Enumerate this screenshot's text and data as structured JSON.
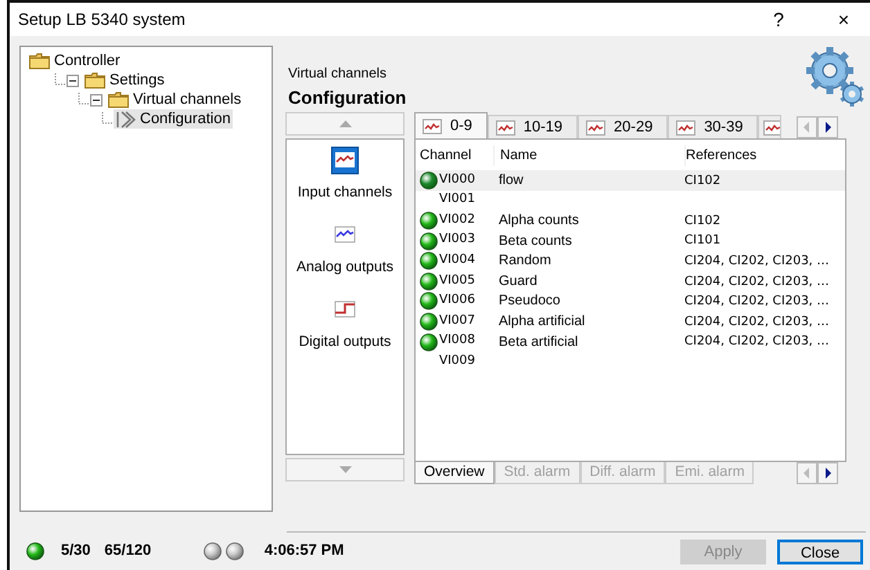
{
  "window": {
    "title": "Setup LB 5340 system",
    "help": "?",
    "close": "×"
  },
  "tree": [
    {
      "label": "Controller",
      "kind": "folder",
      "selected": false,
      "children": [
        {
          "label": "Settings",
          "kind": "folder",
          "expanded": true,
          "selected": false,
          "children": [
            {
              "label": "Virtual channels",
              "kind": "folder",
              "expanded": true,
              "selected": false,
              "children": [
                {
                  "label": "Configuration",
                  "kind": "page",
                  "selected": true
                }
              ]
            }
          ]
        }
      ]
    }
  ],
  "header": {
    "subtitle": "Virtual channels",
    "title": "Configuration"
  },
  "nav": {
    "items": [
      {
        "label": "Input channels",
        "kind": "input",
        "selected": true
      },
      {
        "label": "Analog outputs",
        "kind": "analog",
        "selected": false
      },
      {
        "label": "Digital outputs",
        "kind": "digital",
        "selected": false
      }
    ]
  },
  "tabs": [
    {
      "label": "0-9",
      "selected": true
    },
    {
      "label": "10-19",
      "selected": false
    },
    {
      "label": "20-29",
      "selected": false
    },
    {
      "label": "30-39",
      "selected": false
    },
    {
      "selected": false
    }
  ],
  "table": {
    "columns": [
      "Channel",
      "Name",
      "References"
    ],
    "rows": [
      {
        "channel": "VI000",
        "name": "flow",
        "references": "CI102",
        "led": true,
        "selected": true
      },
      {
        "channel": "VI001",
        "led": false,
        "selected": false
      },
      {
        "channel": "VI002",
        "name": "Alpha counts",
        "references": "CI102",
        "led": true,
        "selected": false
      },
      {
        "channel": "VI003",
        "name": "Beta counts",
        "references": "CI101",
        "led": true,
        "selected": false
      },
      {
        "channel": "VI004",
        "name": "Random",
        "references": "CI204, CI202, CI203, …",
        "led": true,
        "selected": false
      },
      {
        "channel": "VI005",
        "name": "Guard",
        "references": "CI204, CI202, CI203, …",
        "led": true,
        "selected": false
      },
      {
        "channel": "VI006",
        "name": "Pseudoco",
        "references": "CI204, CI202, CI203, …",
        "led": true,
        "selected": false
      },
      {
        "channel": "VI007",
        "name": "Alpha artificial",
        "references": "CI204, CI202, CI203, …",
        "led": true,
        "selected": false
      },
      {
        "channel": "VI008",
        "name": "Beta artificial",
        "references": "CI204, CI202, CI203, …",
        "led": true,
        "selected": false
      },
      {
        "channel": "VI009",
        "led": false,
        "selected": false
      }
    ]
  },
  "bottom_tabs": [
    {
      "label": "Overview",
      "selected": true
    },
    {
      "label": "Std. alarm",
      "selected": false
    },
    {
      "label": "Diff. alarm",
      "selected": false
    },
    {
      "label": "Emi. alarm",
      "selected": false
    }
  ],
  "status_bar": {
    "leds": [
      {
        "on": true
      },
      {
        "on": false
      },
      {
        "on": false
      }
    ],
    "counts": [
      "5/30",
      "65/120"
    ],
    "time": "4:06:57 PM"
  },
  "buttons": [
    {
      "label": "Apply",
      "disabled": true,
      "default": false
    },
    {
      "label": "Close",
      "disabled": false,
      "default": true
    }
  ]
}
